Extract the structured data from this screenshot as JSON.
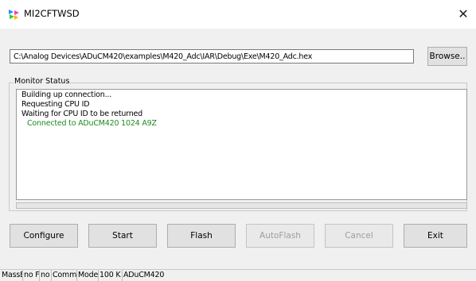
{
  "window": {
    "title": "MI2CFTWSD",
    "close_glyph": "✕",
    "icon": "app-icon"
  },
  "file": {
    "path": "C:\\Analog Devices\\ADuCM420\\examples\\M420_Adc\\IAR\\Debug\\Exe\\M420_Adc.hex",
    "browse_label": "Browse.."
  },
  "monitor": {
    "group_label": "Monitor Status",
    "lines": [
      {
        "text": "Building up connection...",
        "color": "#000000"
      },
      {
        "text": "Requesting CPU ID",
        "color": "#000000"
      },
      {
        "text": "Waiting for CPU ID to be returned",
        "color": "#000000"
      },
      {
        "text": "Connected to ADuCM420  1024 A9Z",
        "color": "#1d8a1d"
      }
    ],
    "progress_fraction": 0
  },
  "buttons": {
    "configure": "Configure",
    "start": "Start",
    "flash": "Flash",
    "autoflash": "AutoFlash",
    "cancel": "Cancel",
    "exit": "Exit"
  },
  "statusbar": {
    "cells": [
      "MassE",
      "no F",
      "no",
      "Commu",
      "Mode",
      "100 K",
      "ADuCM420"
    ]
  }
}
